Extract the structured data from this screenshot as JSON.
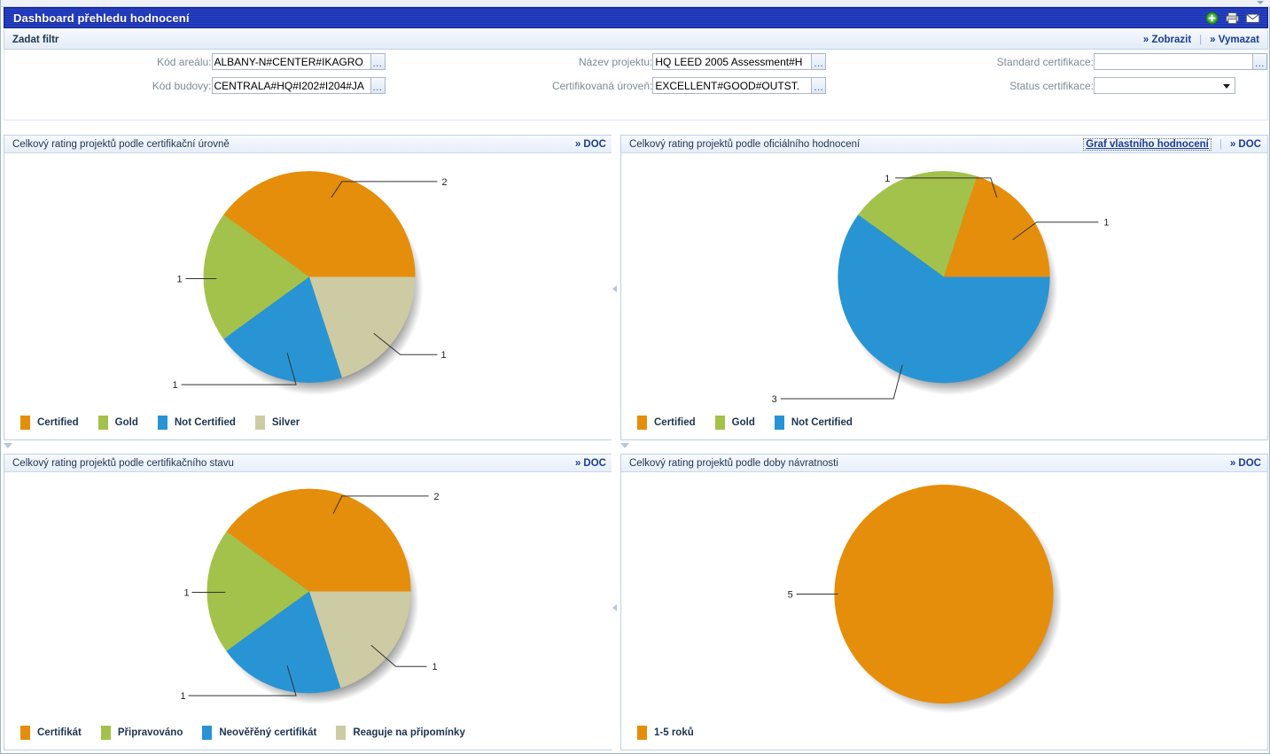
{
  "window": {
    "title": "Dashboard přehledu hodnocení",
    "icons": [
      {
        "name": "add-icon",
        "glyph": "+"
      },
      {
        "name": "print-icon",
        "glyph": "print"
      },
      {
        "name": "mail-icon",
        "glyph": "mail"
      }
    ]
  },
  "filter": {
    "bar_label": "Zadat filtr",
    "show_label": "» Zobrazit",
    "clear_label": "» Vymazat",
    "separator": "|",
    "fields": [
      {
        "label": "Kód areálu:",
        "value": "ALBANY-N#CENTER#IKAGRO",
        "placeholder": "",
        "picker": "...",
        "type": "text-picker"
      },
      {
        "label": "Název projektu:",
        "value": "HQ LEED 2005 Assessment#H",
        "placeholder": "",
        "picker": "...",
        "type": "text-picker"
      },
      {
        "label": "Standard certifikace:",
        "value": "",
        "placeholder": "",
        "picker": "...",
        "type": "text-picker"
      },
      {
        "label": "Kód budovy:",
        "value": "CENTRALA#HQ#I202#I204#JA",
        "placeholder": "",
        "picker": "...",
        "type": "text-picker"
      },
      {
        "label": "Certifikovaná úroveň:",
        "value": "EXCELLENT#GOOD#OUTST.",
        "placeholder": "",
        "picker": "...",
        "type": "text-picker"
      },
      {
        "label": "Status certifikace:",
        "value": "",
        "placeholder": "",
        "type": "select",
        "options": []
      }
    ]
  },
  "palette": {
    "orange": "#E58E0B",
    "green": "#A3C24C",
    "blue": "#2894D4",
    "beige": "#CCCBA3"
  },
  "panels": [
    {
      "id": "panel-certification-level",
      "title": "Celkový rating projektů podle certifikační úrovně",
      "doc_label": "» DOC",
      "extra_action": null
    },
    {
      "id": "panel-official-rating",
      "title": "Celkový rating projektů podle oficiálního hodnocení",
      "doc_label": "» DOC",
      "extra_action": "Graf vlastního hodnocení"
    },
    {
      "id": "panel-certification-status",
      "title": "Celkový rating projektů podle certifikačního stavu",
      "doc_label": "» DOC",
      "extra_action": null
    },
    {
      "id": "panel-payback-period",
      "title": "Celkový rating projektů podle doby návratnosti",
      "doc_label": "» DOC",
      "extra_action": null
    }
  ],
  "chart_data": [
    {
      "id": "chart-certification-level",
      "type": "pie",
      "title": "Celkový rating projektů podle certifikační úrovně",
      "total": 5,
      "legend_position": "bottom",
      "labels": [
        "Certified",
        "Gold",
        "Not Certified",
        "Silver"
      ],
      "values": [
        2,
        1,
        1,
        1
      ],
      "colors": [
        "#E58E0B",
        "#A3C24C",
        "#2894D4",
        "#CCCBA3"
      ],
      "slices": [
        {
          "label": "Certified",
          "value": 2,
          "color": "#E58E0B",
          "start_deg": 0,
          "sweep_deg": 144,
          "callout": "2",
          "callout_side": "top-right"
        },
        {
          "label": "Gold",
          "value": 1,
          "color": "#A3C24C",
          "start_deg": 144,
          "sweep_deg": 72,
          "callout": "1",
          "callout_side": "left"
        },
        {
          "label": "Not Certified",
          "value": 1,
          "color": "#2894D4",
          "start_deg": 216,
          "sweep_deg": 72,
          "callout": "1",
          "callout_side": "bottom-left"
        },
        {
          "label": "Silver",
          "value": 1,
          "color": "#CCCBA3",
          "start_deg": 288,
          "sweep_deg": 72,
          "callout": "1",
          "callout_side": "bottom-right"
        }
      ]
    },
    {
      "id": "chart-official-rating",
      "type": "pie",
      "title": "Celkový rating projektů podle oficiálního hodnocení",
      "total": 5,
      "legend_position": "bottom",
      "labels": [
        "Certified",
        "Gold",
        "Not Certified"
      ],
      "values": [
        1,
        1,
        3
      ],
      "colors": [
        "#E58E0B",
        "#A3C24C",
        "#2894D4"
      ],
      "slices": [
        {
          "label": "Certified",
          "value": 1,
          "color": "#E58E0B",
          "start_deg": 0,
          "sweep_deg": 72,
          "callout": "1",
          "callout_side": "right"
        },
        {
          "label": "Gold",
          "value": 1,
          "color": "#A3C24C",
          "start_deg": 72,
          "sweep_deg": 72,
          "callout": "1",
          "callout_side": "top-left"
        },
        {
          "label": "Not Certified",
          "value": 3,
          "color": "#2894D4",
          "start_deg": 144,
          "sweep_deg": 216,
          "callout": "3",
          "callout_side": "bottom-left"
        }
      ]
    },
    {
      "id": "chart-certification-status",
      "type": "pie",
      "title": "Celkový rating projektů podle certifikačního stavu",
      "total": 5,
      "legend_position": "bottom",
      "labels": [
        "Certifikát",
        "Připravováno",
        "Neověřěný certifikát",
        "Reaguje na připomínky"
      ],
      "values": [
        2,
        1,
        1,
        1
      ],
      "colors": [
        "#E58E0B",
        "#A3C24C",
        "#2894D4",
        "#CCCBA3"
      ],
      "slices": [
        {
          "label": "Certifikát",
          "value": 2,
          "color": "#E58E0B",
          "start_deg": 0,
          "sweep_deg": 144,
          "callout": "2",
          "callout_side": "top-right"
        },
        {
          "label": "Připravováno",
          "value": 1,
          "color": "#A3C24C",
          "start_deg": 144,
          "sweep_deg": 72,
          "callout": "1",
          "callout_side": "left"
        },
        {
          "label": "Neověřěný certifikát",
          "value": 1,
          "color": "#2894D4",
          "start_deg": 216,
          "sweep_deg": 72,
          "callout": "1",
          "callout_side": "bottom-left"
        },
        {
          "label": "Reaguje na připomínky",
          "value": 1,
          "color": "#CCCBA3",
          "start_deg": 288,
          "sweep_deg": 72,
          "callout": "1",
          "callout_side": "bottom-right"
        }
      ]
    },
    {
      "id": "chart-payback-period",
      "type": "pie",
      "title": "Celkový rating projektů podle doby návratnosti",
      "total": 5,
      "legend_position": "bottom",
      "labels": [
        "1-5 roků"
      ],
      "values": [
        5
      ],
      "colors": [
        "#E58E0B"
      ],
      "slices": [
        {
          "label": "1-5 roků",
          "value": 5,
          "color": "#E58E0B",
          "start_deg": 0,
          "sweep_deg": 360,
          "callout": "5",
          "callout_side": "left"
        }
      ]
    }
  ]
}
